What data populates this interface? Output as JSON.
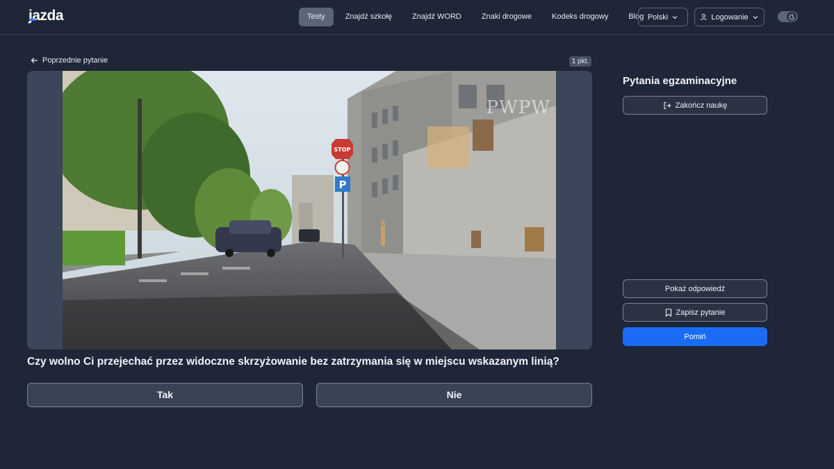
{
  "header": {
    "logo": "jazda",
    "nav": [
      {
        "label": "Testy",
        "active": true
      },
      {
        "label": "Znajdź szkołę",
        "active": false
      },
      {
        "label": "Znajdź WORD",
        "active": false
      },
      {
        "label": "Znaki drogowe",
        "active": false
      },
      {
        "label": "Kodeks drogowy",
        "active": false
      },
      {
        "label": "Blog",
        "active": false
      }
    ],
    "language": "Polski",
    "login": "Logowanie",
    "accent_color": "#1a6cf5"
  },
  "question": {
    "back_label": "Poprzednie pytanie",
    "points": "1 pkt.",
    "image_watermark": "PWPW",
    "sign_text": "STOP",
    "text": "Czy wolno Ci przejechać przez widoczne skrzyżowanie bez zatrzymania się w miejscu wskazanym linią?",
    "answers": [
      "Tak",
      "Nie"
    ]
  },
  "sidebar": {
    "title": "Pytania egzaminacyjne",
    "finish_label": "Zakończ naukę",
    "show_answer_label": "Pokaż odpowiedź",
    "save_label": "Zapisz pytanie",
    "skip_label": "Pomiń"
  }
}
